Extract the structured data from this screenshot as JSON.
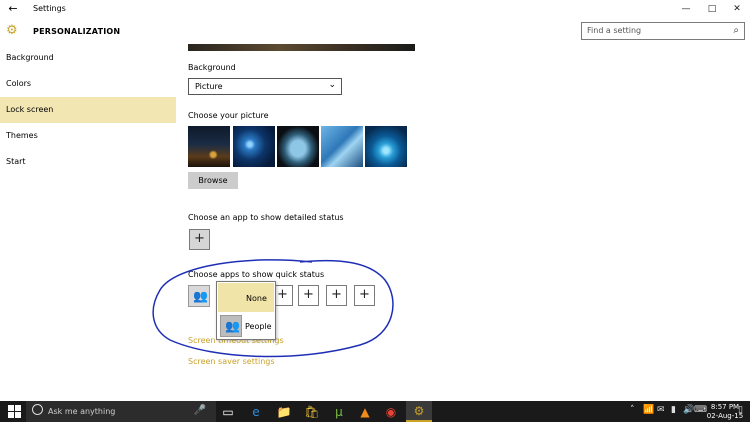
{
  "window": {
    "back_glyph": "←",
    "title": "Settings",
    "min_glyph": "—",
    "max_glyph": "□",
    "close_glyph": "✕"
  },
  "header": {
    "icon": "gear-icon",
    "section": "PERSONALIZATION",
    "search_placeholder": "Find a setting",
    "search_icon": "search-icon"
  },
  "sidebar": {
    "items": [
      {
        "label": "Background",
        "active": false
      },
      {
        "label": "Colors",
        "active": false
      },
      {
        "label": "Lock screen",
        "active": true
      },
      {
        "label": "Themes",
        "active": false
      },
      {
        "label": "Start",
        "active": false
      }
    ]
  },
  "content": {
    "background_label": "Background",
    "background_value": "Picture",
    "choose_picture_label": "Choose your picture",
    "browse_label": "Browse",
    "detailed_status_label": "Choose an app to show detailed status",
    "plus_glyph": "+",
    "quick_status_label": "Choose apps to show quick status",
    "dropdown": {
      "none_label": "None",
      "people_label": "People"
    },
    "link_timeout": "Screen timeout settings",
    "link_saver": "Screen saver settings"
  },
  "annotation_color": "#1f2fb5",
  "accent_color": "#c9a227",
  "taskbar": {
    "search_placeholder": "Ask me anything",
    "clock_time": "8:57 PM",
    "clock_date": "02-Aug-15"
  }
}
